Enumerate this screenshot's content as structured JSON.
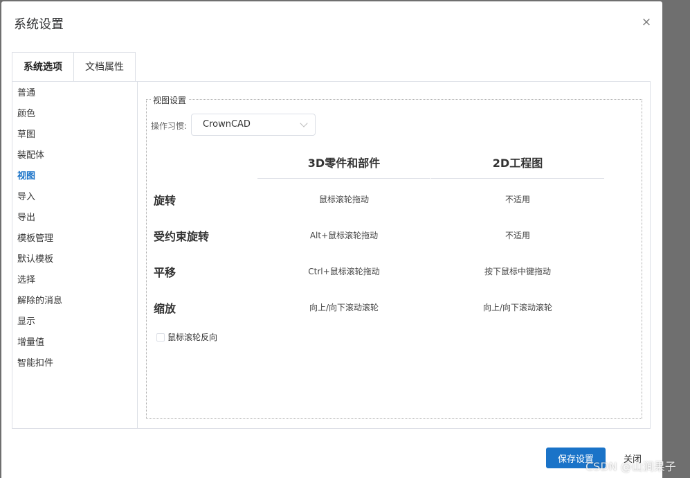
{
  "dialog": {
    "title": "系统设置",
    "close_glyph": "×"
  },
  "tabs": [
    {
      "label": "系统选项",
      "active": true
    },
    {
      "label": "文档属性",
      "active": false
    }
  ],
  "sidebar": {
    "items": [
      {
        "label": "普通"
      },
      {
        "label": "颜色"
      },
      {
        "label": "草图"
      },
      {
        "label": "装配体"
      },
      {
        "label": "视图",
        "active": true
      },
      {
        "label": "导入"
      },
      {
        "label": "导出"
      },
      {
        "label": "模板管理"
      },
      {
        "label": "默认模板"
      },
      {
        "label": "选择"
      },
      {
        "label": "解除的消息"
      },
      {
        "label": "显示"
      },
      {
        "label": "增量值"
      },
      {
        "label": "智能扣件"
      }
    ]
  },
  "view_settings": {
    "legend": "视图设置",
    "habit_label": "操作习惯:",
    "habit_value": "CrownCAD",
    "columns": [
      "3D零件和部件",
      "2D工程图"
    ],
    "rows": [
      {
        "label": "旋转",
        "part": "鼠标滚轮拖动",
        "drawing": "不适用"
      },
      {
        "label": "受约束旋转",
        "part": "Alt+鼠标滚轮拖动",
        "drawing": "不适用"
      },
      {
        "label": "平移",
        "part": "Ctrl+鼠标滚轮拖动",
        "drawing": "按下鼠标中键拖动"
      },
      {
        "label": "缩放",
        "part": "向上/向下滚动滚轮",
        "drawing": "向上/向下滚动滚轮"
      }
    ],
    "reverse_wheel_label": "鼠标滚轮反向"
  },
  "footer": {
    "save_label": "保存设置",
    "close_label": "关闭"
  },
  "watermark": "CSDN @山涧果子",
  "colors": {
    "accent": "#1a73c8",
    "overlay": "#6f6f6f"
  }
}
